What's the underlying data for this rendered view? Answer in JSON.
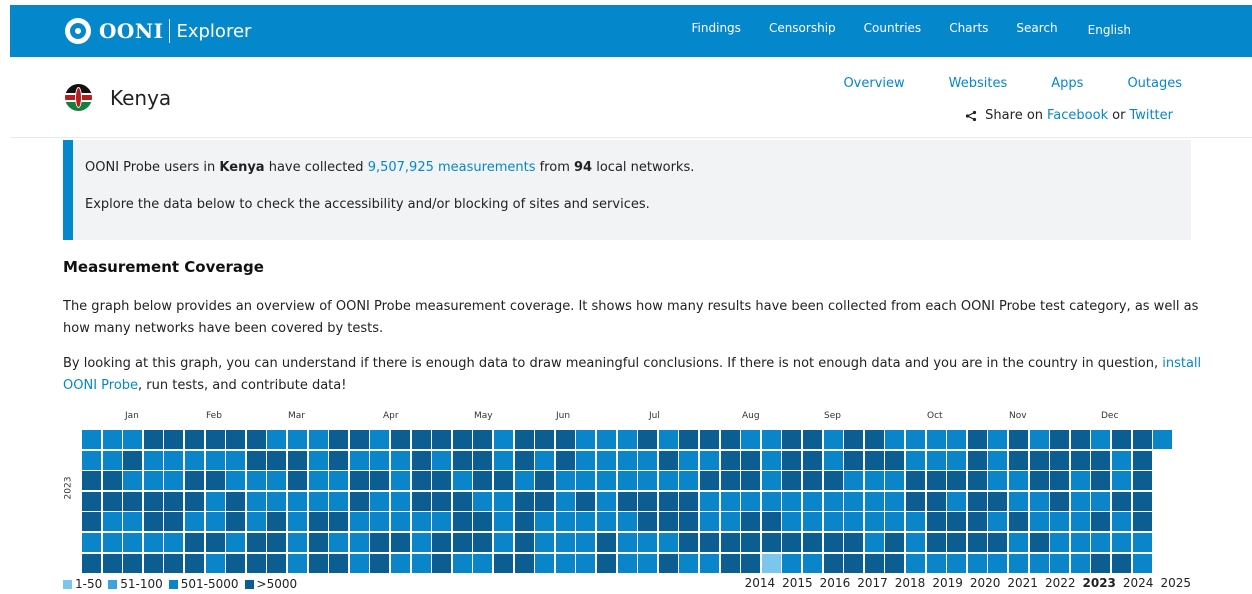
{
  "navbar": {
    "logo_text": "OONI",
    "logo_sub": "Explorer",
    "links": [
      "Findings",
      "Censorship",
      "Countries",
      "Charts",
      "Search",
      "English"
    ]
  },
  "country": {
    "name": "Kenya",
    "tabs": [
      "Overview",
      "Websites",
      "Apps",
      "Outages"
    ],
    "share_prefix": "Share on",
    "share_facebook": "Facebook",
    "share_or": "or",
    "share_twitter": "Twitter"
  },
  "info": {
    "line1_a": "OONI Probe users in ",
    "line1_country": "Kenya",
    "line1_b": " have collected ",
    "line1_link": "9,507,925 measurements",
    "line1_c": " from ",
    "line1_networks": "94",
    "line1_d": " local networks.",
    "line2": "Explore the data below to check the accessibility and/or blocking of sites and services."
  },
  "coverage": {
    "title": "Measurement Coverage",
    "para1": "The graph below provides an overview of OONI Probe measurement coverage. It shows how many results have been collected from each OONI Probe test category, as well as how many networks have been covered by tests.",
    "para2_a": "By looking at this graph, you can understand if there is enough data to draw meaningful conclusions. If there is not enough data and you are in the country in question, ",
    "para2_link": "install OONI Probe",
    "para2_b": ", run tests, and contribute data!",
    "months": [
      "Jan",
      "Feb",
      "Mar",
      "Apr",
      "May",
      "Jun",
      "Jul",
      "Aug",
      "Sep",
      "Oct",
      "Nov",
      "Dec"
    ],
    "year_label": "2023",
    "legend": [
      {
        "label": "1-50",
        "color": "#7cc6ed"
      },
      {
        "label": "51-100",
        "color": "#3ba4df"
      },
      {
        "label": "501-5000",
        "color": "#0a85c9"
      },
      {
        "label": ">5000",
        "color": "#0c5d91"
      }
    ],
    "years": [
      "2014",
      "2015",
      "2016",
      "2017",
      "2018",
      "2019",
      "2020",
      "2021",
      "2022",
      "2023",
      "2024",
      "2025"
    ],
    "active_year": "2023"
  }
}
